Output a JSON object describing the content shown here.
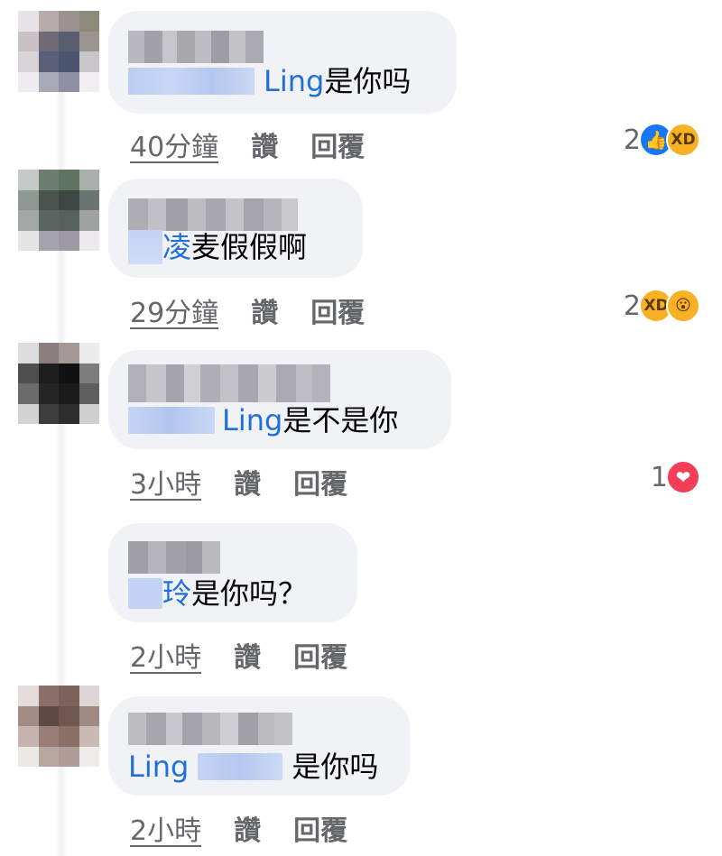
{
  "comments": [
    {
      "id": "c1",
      "mention": "Ling",
      "text": " 是你吗",
      "time": "40分鐘",
      "like_label": "讚",
      "reply_label": "回覆",
      "reaction_count": "2",
      "reactions": [
        "like-icon",
        "haha-icon"
      ]
    },
    {
      "id": "c2",
      "mention": "凌",
      "text": " 麦假假啊",
      "time": "29分鐘",
      "like_label": "讚",
      "reply_label": "回覆",
      "reaction_count": "2",
      "reactions": [
        "haha-icon",
        "wow-icon"
      ]
    },
    {
      "id": "c3",
      "mention": "Ling",
      "text": " 是不是你",
      "time": "3小時",
      "like_label": "讚",
      "reply_label": "回覆",
      "reaction_count": "1",
      "reactions": [
        "love-icon"
      ]
    },
    {
      "id": "c4",
      "mention": "玲",
      "text": "是你吗？",
      "time": "2小時",
      "like_label": "讚",
      "reply_label": "回覆"
    },
    {
      "id": "c5",
      "mention": "Ling",
      "text": "是你吗",
      "time": "2小時",
      "like_label": "讚",
      "reply_label": "回覆"
    }
  ],
  "colors": {
    "bubble": "#f0f2f5",
    "mention": "#216fdb",
    "meta_text": "#65676b",
    "like_reaction": "#1877f2",
    "love_reaction": "#f33e58",
    "haha_reaction": "#f7b125"
  }
}
